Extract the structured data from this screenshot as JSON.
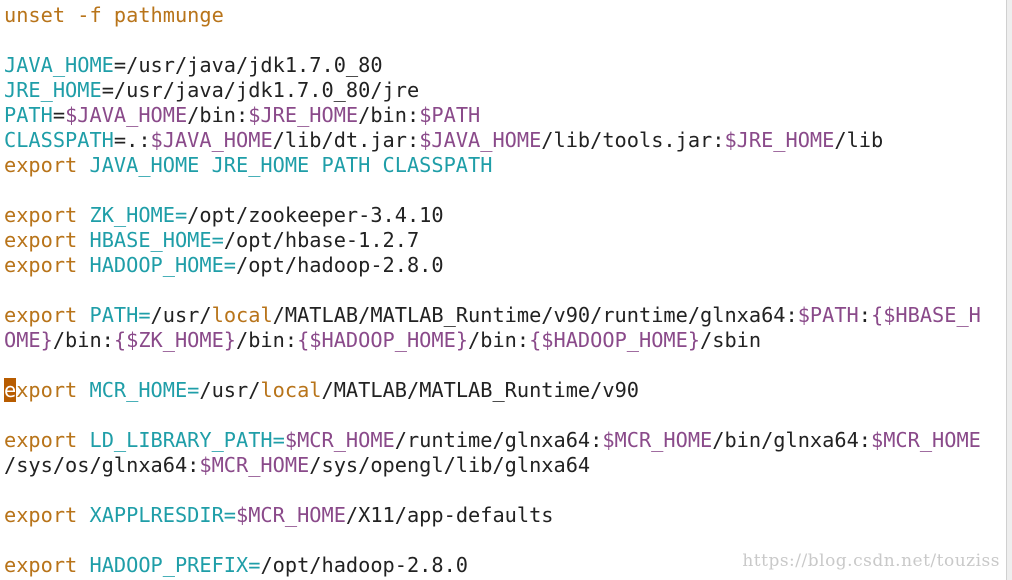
{
  "editor": {
    "lines": [
      [
        {
          "t": "unset -f pathmunge",
          "c": "kw"
        }
      ],
      [],
      [
        {
          "t": "JAVA_HOME",
          "c": "var"
        },
        {
          "t": "=/usr/java/jdk1.7.0_80",
          "c": "path"
        }
      ],
      [
        {
          "t": "JRE_HOME",
          "c": "var"
        },
        {
          "t": "=/usr/java/jdk1.7.0_80/jre",
          "c": "path"
        }
      ],
      [
        {
          "t": "PATH",
          "c": "var"
        },
        {
          "t": "=",
          "c": "path"
        },
        {
          "t": "$JAVA_HOME",
          "c": "dollar"
        },
        {
          "t": "/bin:",
          "c": "path"
        },
        {
          "t": "$JRE_HOME",
          "c": "dollar"
        },
        {
          "t": "/bin:",
          "c": "path"
        },
        {
          "t": "$PATH",
          "c": "dollar"
        }
      ],
      [
        {
          "t": "CLASSPATH",
          "c": "var"
        },
        {
          "t": "=.:",
          "c": "path"
        },
        {
          "t": "$JAVA_HOME",
          "c": "dollar"
        },
        {
          "t": "/lib/dt.jar:",
          "c": "path"
        },
        {
          "t": "$JAVA_HOME",
          "c": "dollar"
        },
        {
          "t": "/lib/tools.jar:",
          "c": "path"
        },
        {
          "t": "$JRE_HOME",
          "c": "dollar"
        },
        {
          "t": "/lib",
          "c": "path"
        }
      ],
      [
        {
          "t": "export ",
          "c": "kw"
        },
        {
          "t": "JAVA_HOME JRE_HOME PATH CLASSPATH",
          "c": "var"
        }
      ],
      [],
      [
        {
          "t": "export ",
          "c": "kw"
        },
        {
          "t": "ZK_HOME=",
          "c": "var"
        },
        {
          "t": "/opt/zookeeper-3.4.10",
          "c": "path"
        }
      ],
      [
        {
          "t": "export ",
          "c": "kw"
        },
        {
          "t": "HBASE_HOME=",
          "c": "var"
        },
        {
          "t": "/opt/hbase-1.2.7",
          "c": "path"
        }
      ],
      [
        {
          "t": "export ",
          "c": "kw"
        },
        {
          "t": "HADOOP_HOME=",
          "c": "var"
        },
        {
          "t": "/opt/hadoop-2.8.0",
          "c": "path"
        }
      ],
      [],
      [
        {
          "t": "export ",
          "c": "kw"
        },
        {
          "t": "PATH=",
          "c": "var"
        },
        {
          "t": "/usr/",
          "c": "path"
        },
        {
          "t": "local",
          "c": "kw"
        },
        {
          "t": "/MATLAB/MATLAB_Runtime/v90/runtime/glnxa64:",
          "c": "path"
        },
        {
          "t": "$PATH",
          "c": "dollar"
        },
        {
          "t": ":",
          "c": "path"
        },
        {
          "t": "{$HBASE_H",
          "c": "dollar"
        }
      ],
      [
        {
          "t": "OME}",
          "c": "dollar"
        },
        {
          "t": "/bin:",
          "c": "path"
        },
        {
          "t": "{$ZK_HOME}",
          "c": "dollar"
        },
        {
          "t": "/bin:",
          "c": "path"
        },
        {
          "t": "{$HADOOP_HOME}",
          "c": "dollar"
        },
        {
          "t": "/bin:",
          "c": "path"
        },
        {
          "t": "{$HADOOP_HOME}",
          "c": "dollar"
        },
        {
          "t": "/sbin",
          "c": "path"
        }
      ],
      [],
      [
        {
          "t": "e",
          "c": "cursor"
        },
        {
          "t": "xport ",
          "c": "kw"
        },
        {
          "t": "MCR_HOME=",
          "c": "var"
        },
        {
          "t": "/usr/",
          "c": "path"
        },
        {
          "t": "local",
          "c": "kw"
        },
        {
          "t": "/MATLAB/MATLAB_Runtime/v90",
          "c": "path"
        }
      ],
      [],
      [
        {
          "t": "export ",
          "c": "kw"
        },
        {
          "t": "LD_LIBRARY_PATH=",
          "c": "var"
        },
        {
          "t": "$MCR_HOME",
          "c": "dollar"
        },
        {
          "t": "/runtime/glnxa64:",
          "c": "path"
        },
        {
          "t": "$MCR_HOME",
          "c": "dollar"
        },
        {
          "t": "/bin/glnxa64:",
          "c": "path"
        },
        {
          "t": "$MCR_HOME",
          "c": "dollar"
        }
      ],
      [
        {
          "t": "/sys/os/glnxa64:",
          "c": "path"
        },
        {
          "t": "$MCR_HOME",
          "c": "dollar"
        },
        {
          "t": "/sys/opengl/lib/glnxa64",
          "c": "path"
        }
      ],
      [],
      [
        {
          "t": "export ",
          "c": "kw"
        },
        {
          "t": "XAPPLRESDIR=",
          "c": "var"
        },
        {
          "t": "$MCR_HOME",
          "c": "dollar"
        },
        {
          "t": "/X11/app-defaults",
          "c": "path"
        }
      ],
      [],
      [
        {
          "t": "export ",
          "c": "kw"
        },
        {
          "t": "HADOOP_PREFIX=",
          "c": "var"
        },
        {
          "t": "/opt/hadoop-2.8.0",
          "c": "path"
        }
      ]
    ]
  },
  "watermark": "https://blog.csdn.net/touziss"
}
